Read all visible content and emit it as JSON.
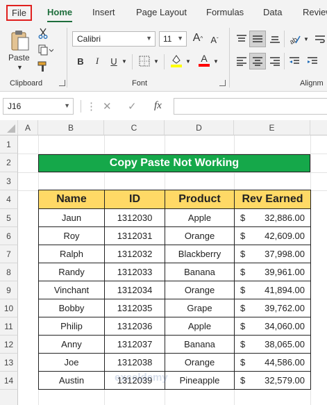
{
  "ribbon": {
    "tabs": [
      "File",
      "Home",
      "Insert",
      "Page Layout",
      "Formulas",
      "Data",
      "Review"
    ],
    "clipboard": {
      "paste_label": "Paste",
      "group_label": "Clipboard"
    },
    "font": {
      "family": "Calibri",
      "size": "11",
      "group_label": "Font",
      "bold": "B",
      "italic": "I",
      "underline": "U"
    },
    "alignment": {
      "group_label": "Alignm"
    },
    "colors": {
      "highlight": "#ffff00",
      "font_color": "#ff0000",
      "accent": "#1e6e3c"
    }
  },
  "formula_bar": {
    "cell_ref": "J16",
    "fx": "fx",
    "value": ""
  },
  "grid": {
    "columns": [
      "A",
      "B",
      "C",
      "D",
      "E"
    ],
    "rows": [
      "1",
      "2",
      "3",
      "4",
      "5",
      "6",
      "7",
      "8",
      "9",
      "10",
      "11",
      "12",
      "13",
      "14"
    ]
  },
  "sheet": {
    "title": "Copy Paste Not Working",
    "title_color": "#15a84a",
    "header_color": "#ffd966",
    "headers": [
      "Name",
      "ID",
      "Product",
      "Rev Earned"
    ],
    "currency": "$",
    "rows": [
      {
        "name": "Jaun",
        "id": "1312030",
        "product": "Apple",
        "rev": "32,886.00"
      },
      {
        "name": "Roy",
        "id": "1312031",
        "product": "Orange",
        "rev": "42,609.00"
      },
      {
        "name": "Ralph",
        "id": "1312032",
        "product": "Blackberry",
        "rev": "37,998.00"
      },
      {
        "name": "Randy",
        "id": "1312033",
        "product": "Banana",
        "rev": "39,961.00"
      },
      {
        "name": "Vinchant",
        "id": "1312034",
        "product": "Orange",
        "rev": "41,894.00"
      },
      {
        "name": "Bobby",
        "id": "1312035",
        "product": "Grape",
        "rev": "39,762.00"
      },
      {
        "name": "Philip",
        "id": "1312036",
        "product": "Apple",
        "rev": "34,060.00"
      },
      {
        "name": "Anny",
        "id": "1312037",
        "product": "Banana",
        "rev": "38,065.00"
      },
      {
        "name": "Joe",
        "id": "1312038",
        "product": "Orange",
        "rev": "44,586.00"
      },
      {
        "name": "Austin",
        "id": "1312039",
        "product": "Pineapple",
        "rev": "32,579.00"
      }
    ]
  },
  "watermark": "exceldemy"
}
